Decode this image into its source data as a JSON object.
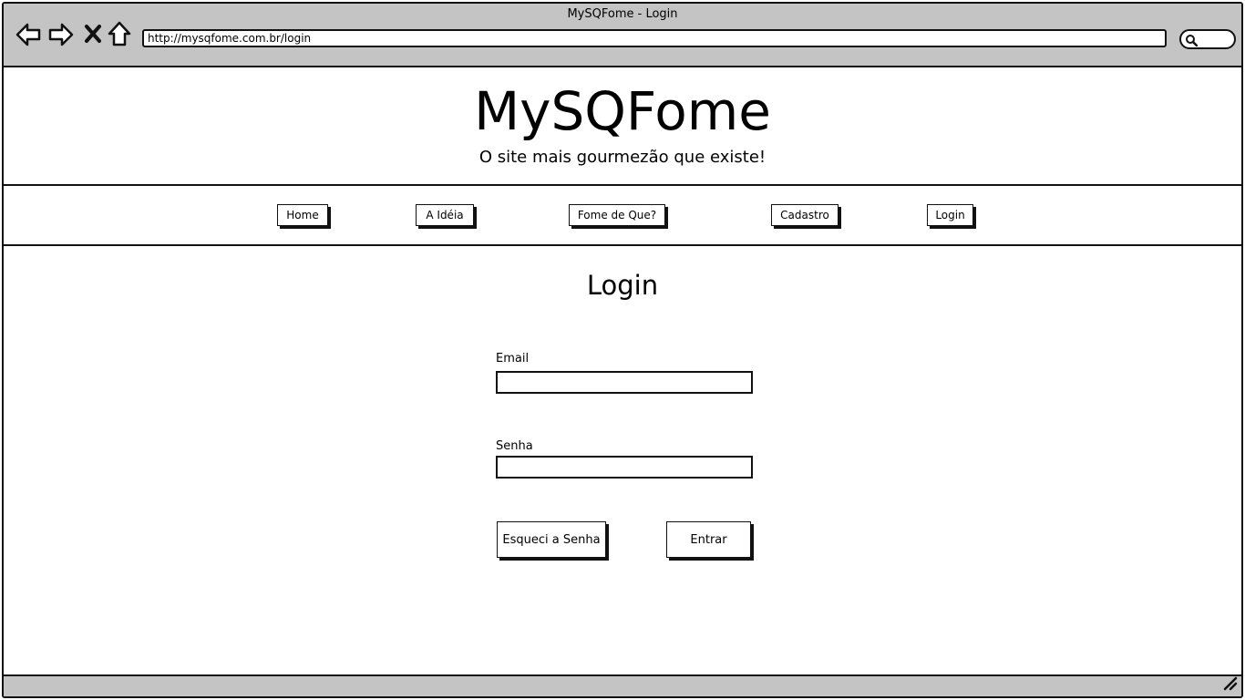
{
  "window": {
    "title": "MySQFome - Login"
  },
  "browser": {
    "url": "http://mysqfome.com.br/login",
    "icons": [
      "back-arrow-icon",
      "forward-arrow-icon",
      "stop-icon",
      "home-icon",
      "search-icon"
    ]
  },
  "header": {
    "title": "MySQFome",
    "subtitle": "O site mais gourmezão que existe!"
  },
  "nav": {
    "items": [
      {
        "label": "Home"
      },
      {
        "label": "A Idéia"
      },
      {
        "label": "Fome de Que?"
      },
      {
        "label": "Cadastro"
      },
      {
        "label": "Login"
      }
    ]
  },
  "login": {
    "heading": "Login",
    "email_label": "Email",
    "email_value": "",
    "password_label": "Senha",
    "password_value": "",
    "forgot_label": "Esqueci a Senha",
    "submit_label": "Entrar"
  }
}
